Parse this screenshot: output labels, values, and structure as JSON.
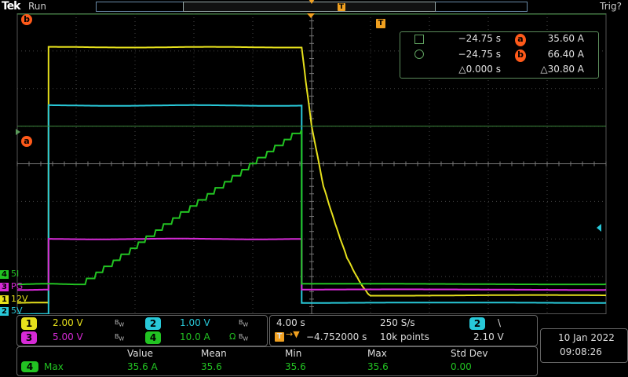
{
  "header": {
    "brand": "Tek",
    "run_state": "Run",
    "trigger_state": "Trig?",
    "trigger_marker": "T"
  },
  "cursors": {
    "a_label": "a",
    "b_label": "b",
    "readout": {
      "row1_time": "−24.75 s",
      "row1_value": "35.60 A",
      "row2_time": "−24.75 s",
      "row2_value": "66.40 A",
      "delta_time": "△0.000 s",
      "delta_value": "△30.80 A"
    }
  },
  "channel_labels": [
    {
      "num": "4",
      "text": "5I",
      "color": "#22c322"
    },
    {
      "num": "3",
      "text": "PG",
      "color": "#d62ad6"
    },
    {
      "num": "1",
      "text": "12V",
      "color": "#e6e01c"
    },
    {
      "num": "2",
      "text": "5V",
      "color": "#28c8d8"
    }
  ],
  "vertical": {
    "ch1": {
      "num": "1",
      "scale": "2.00 V",
      "color": "#e6e01c"
    },
    "ch2": {
      "num": "2",
      "scale": "1.00 V",
      "color": "#28c8d8"
    },
    "ch3": {
      "num": "3",
      "scale": "5.00 V",
      "color": "#d62ad6"
    },
    "ch4": {
      "num": "4",
      "scale": "10.0 A",
      "color": "#22c322"
    },
    "bw_mark": "B",
    "bw_sub": "W"
  },
  "horizontal": {
    "time_div": "4.00 s",
    "sample_rate": "250 S/s",
    "trigger_icon": "T",
    "position": "−4.752000 s",
    "record_length": "10k points",
    "trigger_channel": "2",
    "trigger_slope": "\\",
    "trigger_level": "2.10 V"
  },
  "clock": {
    "date": "10 Jan  2022",
    "time": "09:08:26"
  },
  "measurements": {
    "headers": [
      "Value",
      "Mean",
      "Min",
      "Max",
      "Std Dev"
    ],
    "rows": [
      {
        "channel": "4",
        "name": "Max",
        "value": "35.6 A",
        "mean": "35.6",
        "min": "35.6",
        "max": "35.6",
        "std": "0.00"
      }
    ]
  },
  "chart_data": {
    "type": "line",
    "time_per_div_s": 4,
    "h_divisions": 10,
    "v_divisions": 8,
    "x_range_div": [
      0,
      10
    ],
    "y_range_div": [
      -4,
      4
    ],
    "grid": true,
    "series": [
      {
        "name": "12V",
        "color": "#e6e01c",
        "points_div": [
          [
            0,
            -3.7
          ],
          [
            0.53,
            -3.7
          ],
          [
            0.53,
            3.1
          ],
          [
            4.83,
            3.1
          ],
          [
            4.9,
            2.2
          ],
          [
            5.0,
            1.0
          ],
          [
            5.2,
            -0.6
          ],
          [
            5.4,
            -1.6
          ],
          [
            5.6,
            -2.5
          ],
          [
            5.8,
            -3.1
          ],
          [
            5.95,
            -3.45
          ],
          [
            6.0,
            -3.5
          ],
          [
            10,
            -3.5
          ]
        ]
      },
      {
        "name": "5V",
        "color": "#28c8d8",
        "points_div": [
          [
            0,
            -4.0
          ],
          [
            0.53,
            -4.0
          ],
          [
            0.53,
            1.55
          ],
          [
            4.83,
            1.55
          ],
          [
            4.83,
            -3.7
          ],
          [
            10,
            -3.7
          ]
        ]
      },
      {
        "name": "PG",
        "color": "#d62ad6",
        "points_div": [
          [
            0,
            -3.35
          ],
          [
            0.53,
            -3.35
          ],
          [
            0.53,
            -2.0
          ],
          [
            4.83,
            -2.0
          ],
          [
            4.83,
            -3.35
          ],
          [
            10,
            -3.35
          ]
        ]
      },
      {
        "name": "5I",
        "color": "#22c322",
        "points_div": [
          [
            0,
            -3.2
          ],
          [
            1.1,
            -3.2
          ],
          [
            4.83,
            0.9
          ],
          [
            4.83,
            -3.2
          ],
          [
            10,
            -3.2
          ]
        ]
      }
    ],
    "cursor_a_level_div": 1.0,
    "cursor_b_level_div": 4.0
  }
}
